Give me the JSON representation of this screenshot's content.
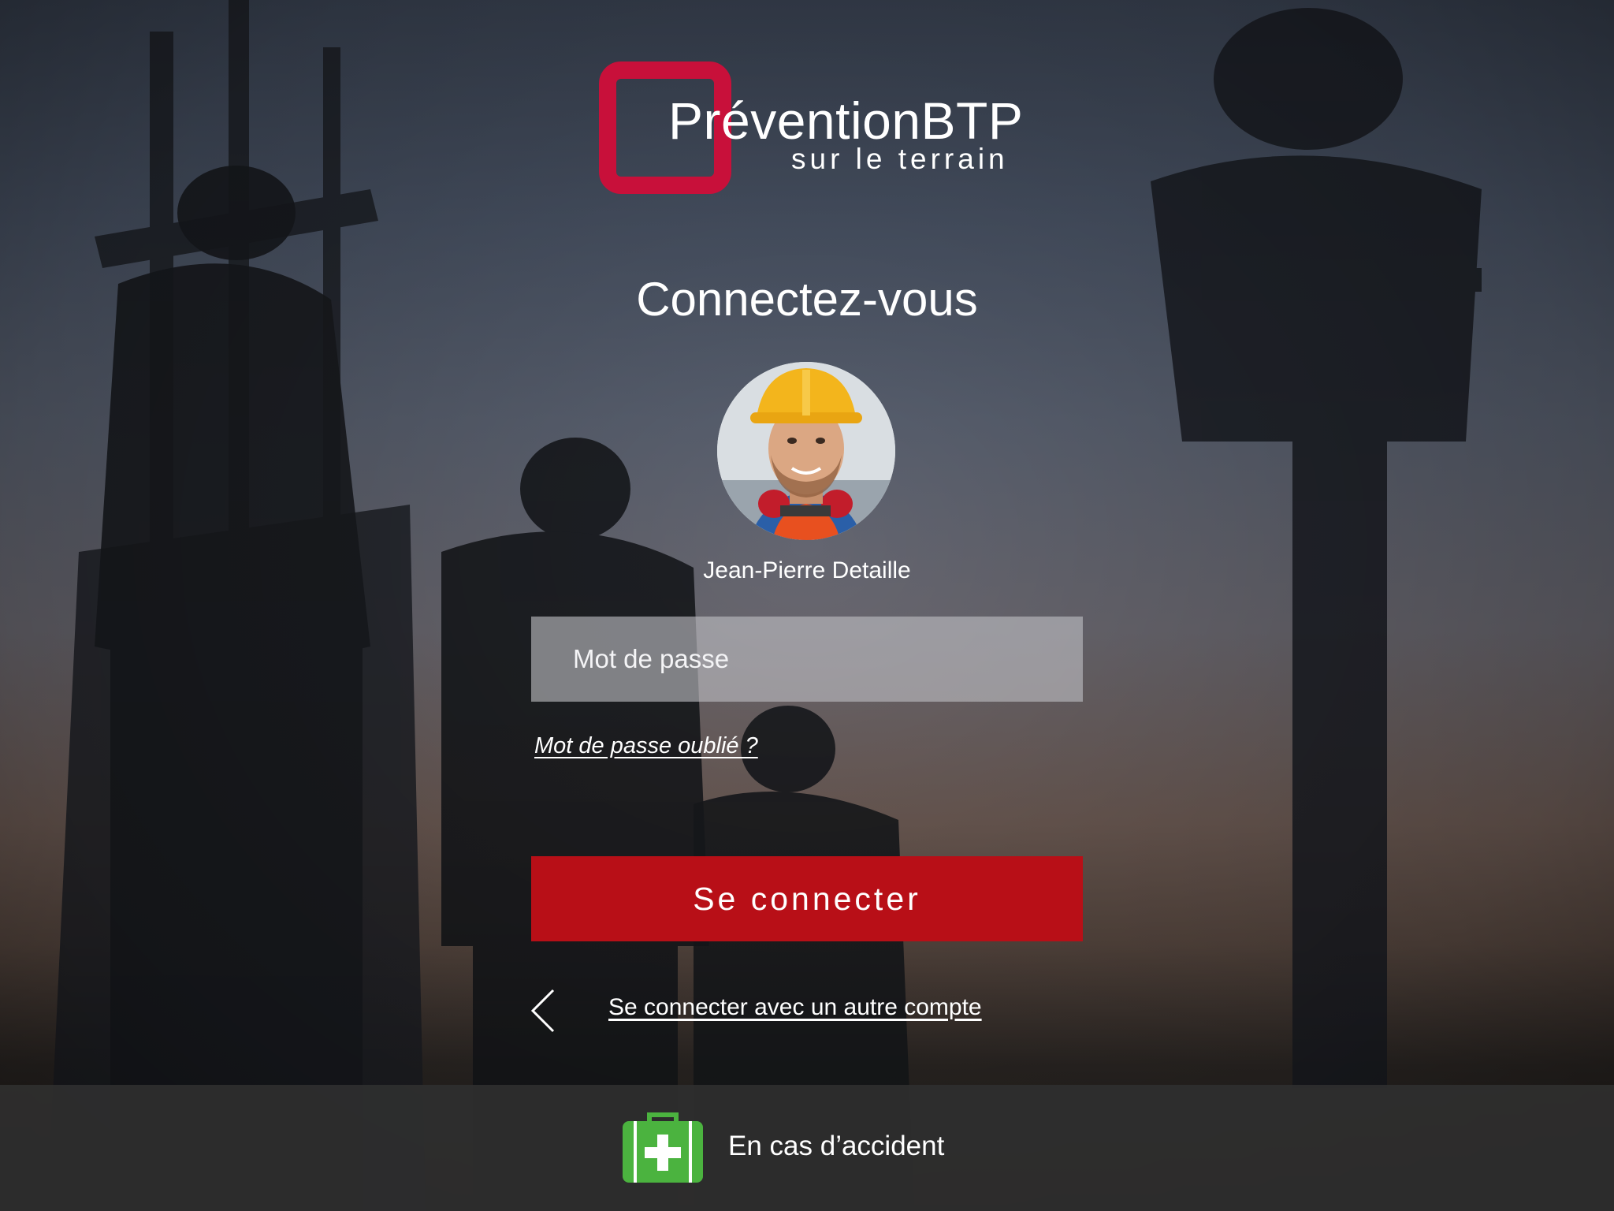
{
  "logo": {
    "title": "PréventionBTP",
    "subtitle": "sur le terrain"
  },
  "login": {
    "heading": "Connectez-vous",
    "user_name": "Jean-Pierre Detaille",
    "password_placeholder": "Mot de passe",
    "forgot_link": "Mot de passe oublié ?",
    "submit_label": "Se connecter",
    "other_account_link": "Se connecter avec un autre compte"
  },
  "footer": {
    "accident_label": "En cas d’accident",
    "icon": "first-aid-kit-icon"
  },
  "colors": {
    "brand_red": "#c8103a",
    "button_red": "#b80f17",
    "kit_green": "#4bb33f",
    "bottom_bar": "#2e2e2e"
  }
}
